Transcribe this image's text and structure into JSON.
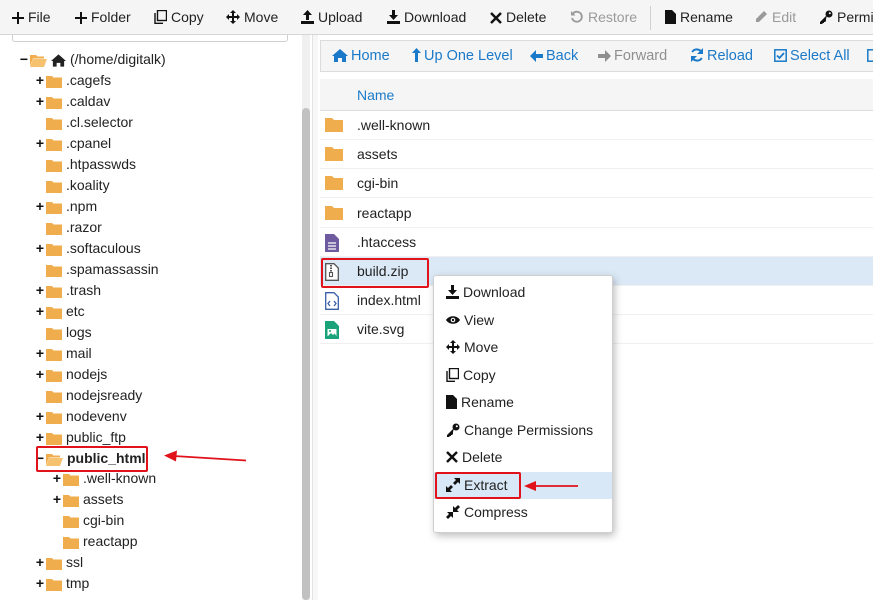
{
  "toolbar": {
    "file": "File",
    "folder": "Folder",
    "copy": "Copy",
    "move": "Move",
    "upload": "Upload",
    "download": "Download",
    "delete": "Delete",
    "restore": "Restore",
    "rename": "Rename",
    "edit": "Edit",
    "permissions": "Permi"
  },
  "tree": {
    "root": "(/home/digitalk)",
    "items": [
      ".cagefs",
      ".caldav",
      ".cl.selector",
      ".cpanel",
      ".htpasswds",
      ".koality",
      ".npm",
      ".razor",
      ".softaculous",
      ".spamassassin",
      ".trash",
      "etc",
      "logs",
      "mail",
      "nodejs",
      "nodejsready",
      "nodevenv",
      "public_ftp",
      "public_html",
      ".well-known",
      "assets",
      "cgi-bin",
      "reactapp",
      "ssl",
      "tmp"
    ]
  },
  "nav": {
    "home": "Home",
    "up": "Up One Level",
    "back": "Back",
    "forward": "Forward",
    "reload": "Reload",
    "select_all": "Select All"
  },
  "table": {
    "col_name": "Name",
    "files": [
      ".well-known",
      "assets",
      "cgi-bin",
      "reactapp",
      ".htaccess",
      "build.zip",
      "index.html",
      "vite.svg"
    ]
  },
  "context_menu": {
    "items": [
      "Download",
      "View",
      "Move",
      "Copy",
      "Rename",
      "Change Permissions",
      "Delete",
      "Extract",
      "Compress"
    ]
  },
  "colors": {
    "link": "#1a7ac9",
    "folder": "#f0ad4e",
    "annotation": "#e1121a",
    "selection": "#dbe9f6"
  }
}
